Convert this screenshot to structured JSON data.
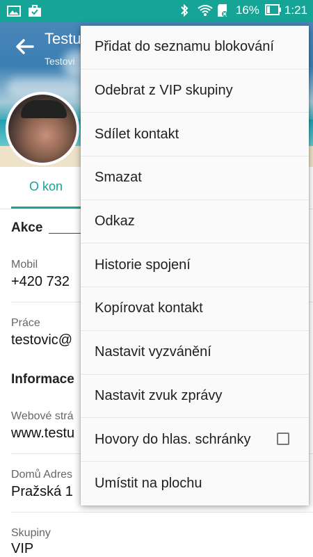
{
  "status_bar": {
    "battery_percent": "16%",
    "time": "1:21"
  },
  "contact": {
    "name": "Testu",
    "subtitle": "Testovi"
  },
  "tabs": {
    "active_label": "O kon"
  },
  "details": {
    "section_actions": "Akce",
    "mobile_label": "Mobil",
    "mobile_value": "+420 732",
    "work_label": "Práce",
    "work_value": "testovic@",
    "section_info": "Informace",
    "web_label": "Webové strá",
    "web_value": "www.testu",
    "address_label": "Domů Adres",
    "address_value": "Pražská 1",
    "groups_label": "Skupiny",
    "groups_value": "VIP"
  },
  "menu": {
    "items": [
      {
        "label": "Přidat do seznamu blokování"
      },
      {
        "label": "Odebrat z VIP skupiny"
      },
      {
        "label": "Sdílet kontakt"
      },
      {
        "label": "Smazat"
      },
      {
        "label": "Odkaz"
      },
      {
        "label": "Historie spojení"
      },
      {
        "label": "Kopírovat kontakt"
      },
      {
        "label": "Nastavit vyzvánění"
      },
      {
        "label": "Nastavit zvuk zprávy"
      },
      {
        "label": "Hovory do hlas. schránky",
        "checked": false
      },
      {
        "label": "Umístit na plochu"
      }
    ]
  },
  "colors": {
    "accent": "#16a496",
    "menu_bg": "#fafafa",
    "text": "#1f1f1f"
  },
  "icons": [
    "gallery-icon",
    "briefcase-icon",
    "bluetooth-icon",
    "wifi-icon",
    "sd-card-icon",
    "battery-icon",
    "back-arrow-icon",
    "checkbox-icon"
  ]
}
